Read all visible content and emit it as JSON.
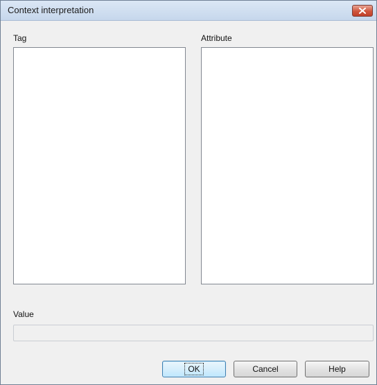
{
  "window": {
    "title": "Context interpretation"
  },
  "tag_list": {
    "label": "Tag",
    "items": []
  },
  "attribute_list": {
    "label": "Attribute",
    "items": []
  },
  "value_field": {
    "label": "Value",
    "value": ""
  },
  "buttons": {
    "ok": "OK",
    "cancel": "Cancel",
    "help": "Help"
  },
  "icons": {
    "close": "close-icon"
  }
}
